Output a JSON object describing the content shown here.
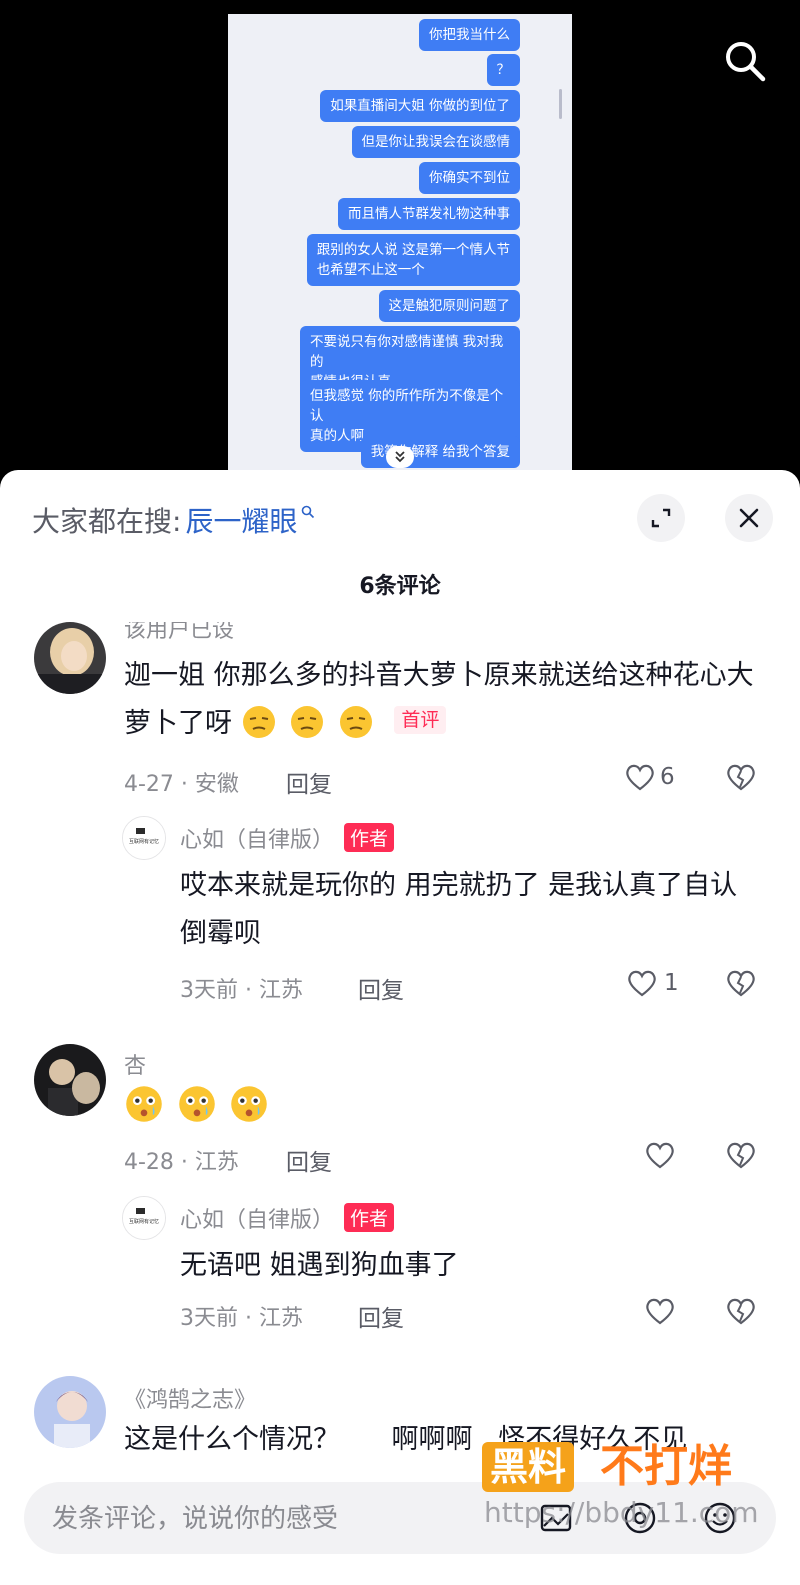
{
  "video": {
    "chat_bubbles": [
      "你把我当什么",
      "？",
      "如果直播间大姐 你做的到位了",
      "但是你让我误会在谈感情",
      "你确实不到位",
      "而且情人节群发礼物这种事",
      "跟别的女人说 这是第一个情人节\n也希望不止这一个",
      "这是触犯原则问题了",
      "不要说只有你对感情谨慎 我对我的\n感情也很认真",
      "但我感觉 你的所作所为不像是个认\n真的人啊",
      "我等你解释 给我个答复"
    ],
    "search_icon": "search-icon",
    "collapse_icon": "chevron-double-down-icon"
  },
  "sheet": {
    "trending_label": "大家都在搜:",
    "trending_keyword": "辰一耀眼",
    "comment_count": "6条评论",
    "comments": [
      {
        "username": "该用户已设",
        "text": "迦一姐 你那么多的抖音大萝卜原来就送给这种花心大萝卜了呀",
        "badge": "首评",
        "meta": "4-27 · 安徽",
        "reply": "回复",
        "likes": "6"
      },
      {
        "username": "心如（自律版）",
        "badge": "作者",
        "text": "哎本来就是玩你的 用完就扔了 是我认真了自认倒霉呗",
        "meta": "3天前 · 江苏",
        "reply": "回复",
        "likes": "1"
      },
      {
        "username": "杏",
        "text": "",
        "meta": "4-28 · 江苏",
        "reply": "回复",
        "likes": ""
      },
      {
        "username": "心如（自律版）",
        "badge": "作者",
        "text": "无语吧 姐遇到狗血事了",
        "meta": "3天前 · 江苏",
        "reply": "回复",
        "likes": ""
      },
      {
        "username": "《鸿鹄之志》",
        "text": "这是什么个情况？      啊啊啊   怪不得好久不见",
        "meta": "",
        "reply": "",
        "likes": ""
      }
    ],
    "input_placeholder": "发条评论，说说你的感受",
    "author_avatar_text": "互联网有记忆"
  },
  "watermark": {
    "box": "黑料",
    "text": "不打烊",
    "url": "https://bbdy11.com"
  },
  "colors": {
    "accent_red": "#fe2c55",
    "link_blue": "#2d63c8",
    "bubble_blue": "#3f7df4"
  }
}
